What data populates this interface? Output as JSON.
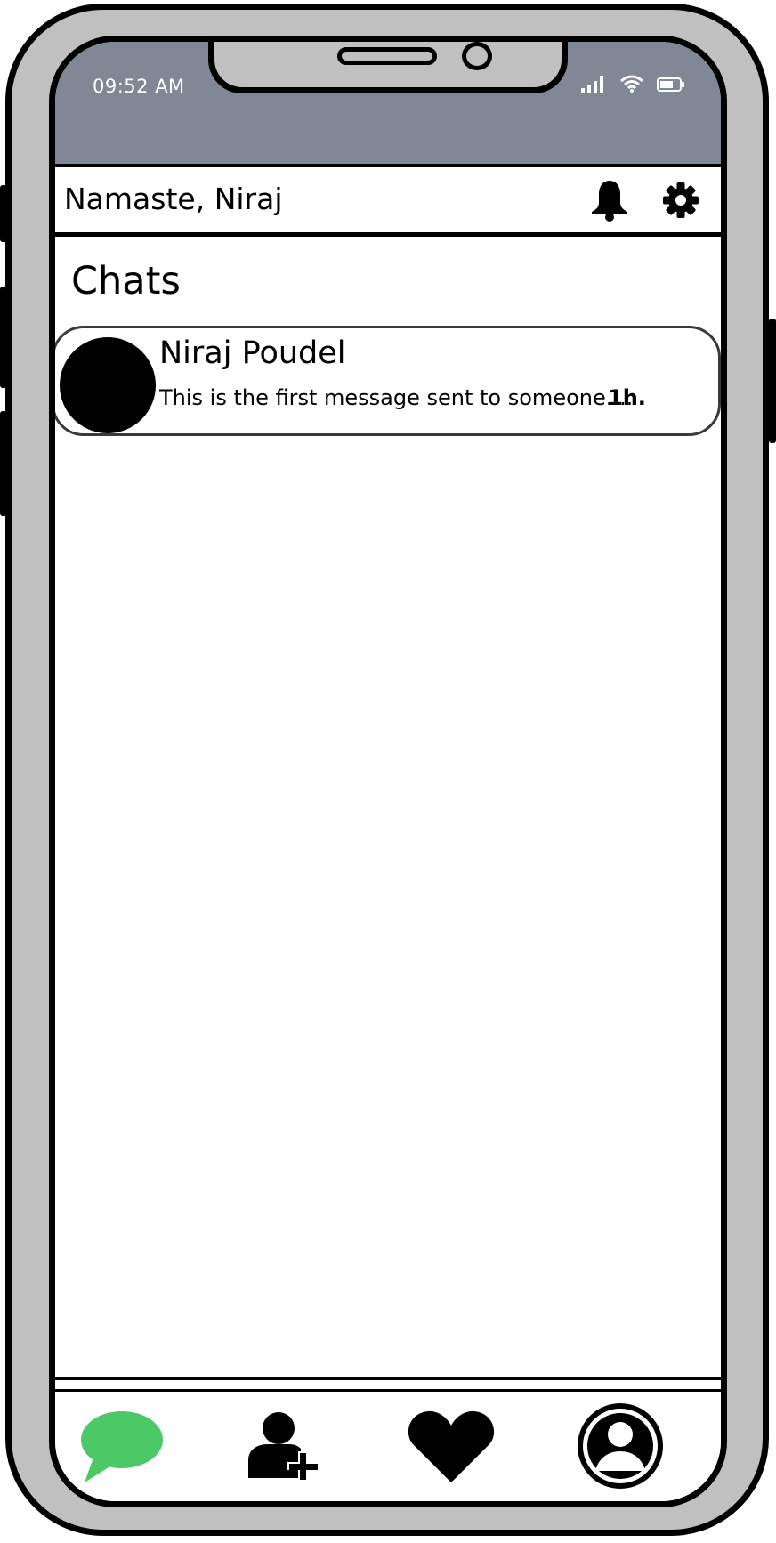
{
  "status_bar": {
    "time": "09:52 AM",
    "icons": [
      "signal-icon",
      "wifi-icon",
      "battery-icon"
    ]
  },
  "header": {
    "greeting": "Namaste, Niraj",
    "icons": [
      "bell-icon",
      "gear-icon"
    ]
  },
  "chats": {
    "title": "Chats",
    "items": [
      {
        "name": "Niraj Poudel",
        "preview": "This is the first message sent to someone....",
        "time": "1h."
      }
    ]
  },
  "tab_bar": {
    "tabs": [
      "chat-bubble-icon",
      "add-user-icon",
      "heart-icon",
      "profile-icon"
    ],
    "active_tab_color": "#4cc966"
  },
  "colors": {
    "status_bar_bg": "#808896",
    "device_body": "#c0c0c0",
    "active_tab": "#4cc966"
  }
}
